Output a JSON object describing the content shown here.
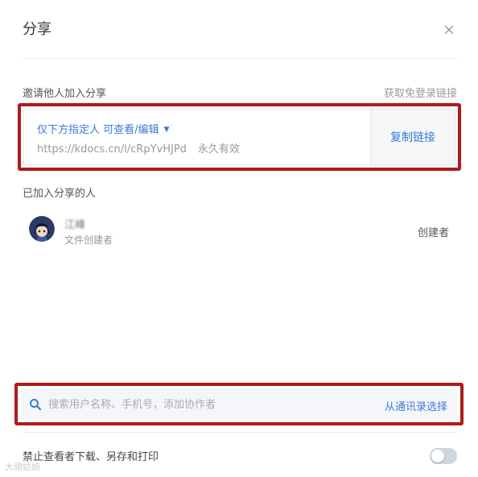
{
  "dialog": {
    "title": "分享"
  },
  "invite": {
    "label": "邀请他人加入分享",
    "free_login_link": "获取免登录链接",
    "permission_label": "仅下方指定人 可查看/编辑",
    "url": "https://kdocs.cn/l/cRpYvHJPd",
    "validity": "永久有效",
    "copy_button": "复制链接"
  },
  "members": {
    "label": "已加入分享的人",
    "list": [
      {
        "name": "江峰",
        "subtitle": "文件创建者",
        "role": "创建者"
      }
    ]
  },
  "search": {
    "placeholder": "搜索用户名称、手机号，添加协作者",
    "contacts_link": "从通讯录选择"
  },
  "settings": {
    "forbid_download_label": "禁止查看者下载、另存和打印",
    "forbid_download_enabled": false
  },
  "watermark": {
    "text": "大頭姑娘"
  },
  "colors": {
    "accent": "#3a7ad6",
    "highlight_border": "#b01a1a"
  },
  "icons": {
    "close": "close-icon",
    "search": "search-icon",
    "caret": "caret-down-icon"
  }
}
